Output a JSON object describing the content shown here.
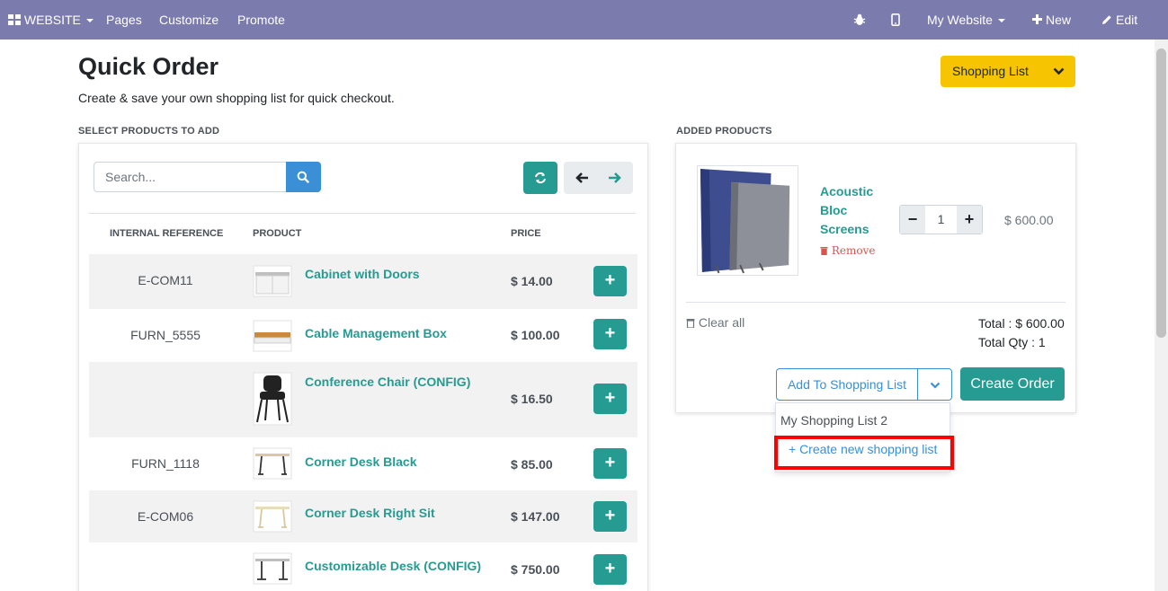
{
  "topbar": {
    "brand": "WEBSITE",
    "menu": [
      "Pages",
      "Customize",
      "Promote"
    ],
    "site": "My Website",
    "new_label": "New",
    "edit_label": "Edit"
  },
  "page": {
    "title": "Quick Order",
    "subtitle": "Create & save your own shopping list for quick checkout.",
    "shopping_list_button": "Shopping List"
  },
  "select_panel": {
    "label": "SELECT PRODUCTS TO ADD",
    "search_placeholder": "Search...",
    "columns": [
      "INTERNAL REFERENCE",
      "PRODUCT",
      "PRICE"
    ],
    "rows": [
      {
        "ref": "E-COM11",
        "name": "Cabinet with Doors",
        "price": "$ 14.00"
      },
      {
        "ref": "FURN_5555",
        "name": "Cable Management Box",
        "price": "$ 100.00"
      },
      {
        "ref": "",
        "name": "Conference Chair (CONFIG)",
        "price": "$ 16.50"
      },
      {
        "ref": "FURN_1118",
        "name": "Corner Desk Black",
        "price": "$ 85.00"
      },
      {
        "ref": "E-COM06",
        "name": "Corner Desk Right Sit",
        "price": "$ 147.00"
      },
      {
        "ref": "",
        "name": "Customizable Desk (CONFIG)",
        "price": "$ 750.00"
      }
    ],
    "add_symbol": "+"
  },
  "added_panel": {
    "label": "ADDED PRODUCTS",
    "item": {
      "name": "Acoustic Bloc Screens",
      "remove_label": "Remove",
      "qty": "1",
      "price": "$ 600.00"
    },
    "clear_all": "Clear all",
    "total": "Total : $ 600.00",
    "total_qty": "Total Qty : 1",
    "add_to_list_label": "Add To Shopping List",
    "create_order_label": "Create Order",
    "dropdown": {
      "existing_list": "My Shopping List 2",
      "create_new": "+ Create new shopping list"
    }
  },
  "colors": {
    "topbar": "#7c7bad",
    "accent_teal": "#269b91",
    "accent_blue": "#3a8fd6",
    "yellow": "#f7c401",
    "highlight": "#ff0000"
  }
}
